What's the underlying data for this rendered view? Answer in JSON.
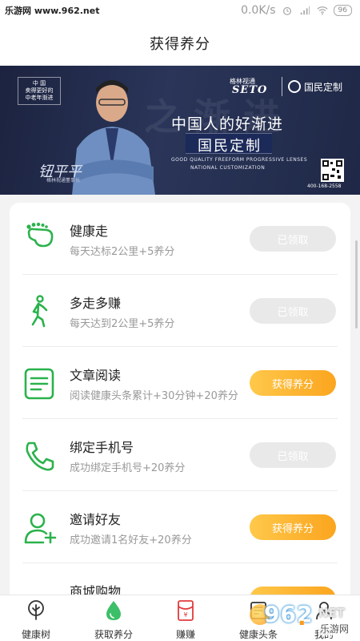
{
  "status_bar": {
    "watermark": "乐游网 www.962.net",
    "speed": "0.0K/s",
    "battery": "96"
  },
  "header": {
    "title": "获得养分"
  },
  "banner": {
    "left_box": {
      "line1": "中 国",
      "line2": "卖得更好的",
      "line3": "中老年渐进"
    },
    "signature": "钮平平",
    "signature_sub": "格林视通董事长",
    "brand_small": "格林视通",
    "brand_seto": "SETO",
    "brand_cn": "国民定制",
    "slogan1": "中国人的好渐进",
    "slogan2": "国民定制",
    "english1": "GOOD QUALITY FREEFORM PROGRESSIVE LENSES",
    "english2": "NATIONAL CUSTOMIZATION",
    "phone": "400-168-2558",
    "watermark_text": "之 渐 进"
  },
  "tasks": [
    {
      "name": "健康走",
      "desc": "每天达标2公里+5养分",
      "button": "已领取",
      "state": "claimed",
      "icon": "footprint-icon"
    },
    {
      "name": "多走多赚",
      "desc": "每天达到2公里+5养分",
      "button": "已领取",
      "state": "claimed",
      "icon": "walking-person-icon"
    },
    {
      "name": "文章阅读",
      "desc": "阅读健康头条累计+30分钟+20养分",
      "button": "获得养分",
      "state": "available",
      "icon": "document-icon"
    },
    {
      "name": "绑定手机号",
      "desc": "成功绑定手机号+20养分",
      "button": "已领取",
      "state": "claimed",
      "icon": "phone-icon"
    },
    {
      "name": "邀请好友",
      "desc": "成功邀请1名好友+20养分",
      "button": "获得养分",
      "state": "available",
      "icon": "add-user-icon"
    },
    {
      "name": "商城购物",
      "desc": "",
      "button": "获得养分",
      "state": "available",
      "icon": "cart-icon"
    }
  ],
  "tabbar": [
    {
      "label": "健康树",
      "icon": "tree-icon"
    },
    {
      "label": "获取养分",
      "icon": "water-drop-icon"
    },
    {
      "label": "赚赚",
      "icon": "red-envelope-icon"
    },
    {
      "label": "健康头条",
      "icon": "news-icon"
    },
    {
      "label": "我的",
      "icon": "profile-icon"
    }
  ],
  "site_watermark": {
    "num": "962",
    "dot": ".",
    "net": "NET",
    "cn": "乐游网"
  },
  "colors": {
    "accent_orange": "#fba51f",
    "green": "#2bb24c",
    "disabled": "#e9e9e9"
  }
}
